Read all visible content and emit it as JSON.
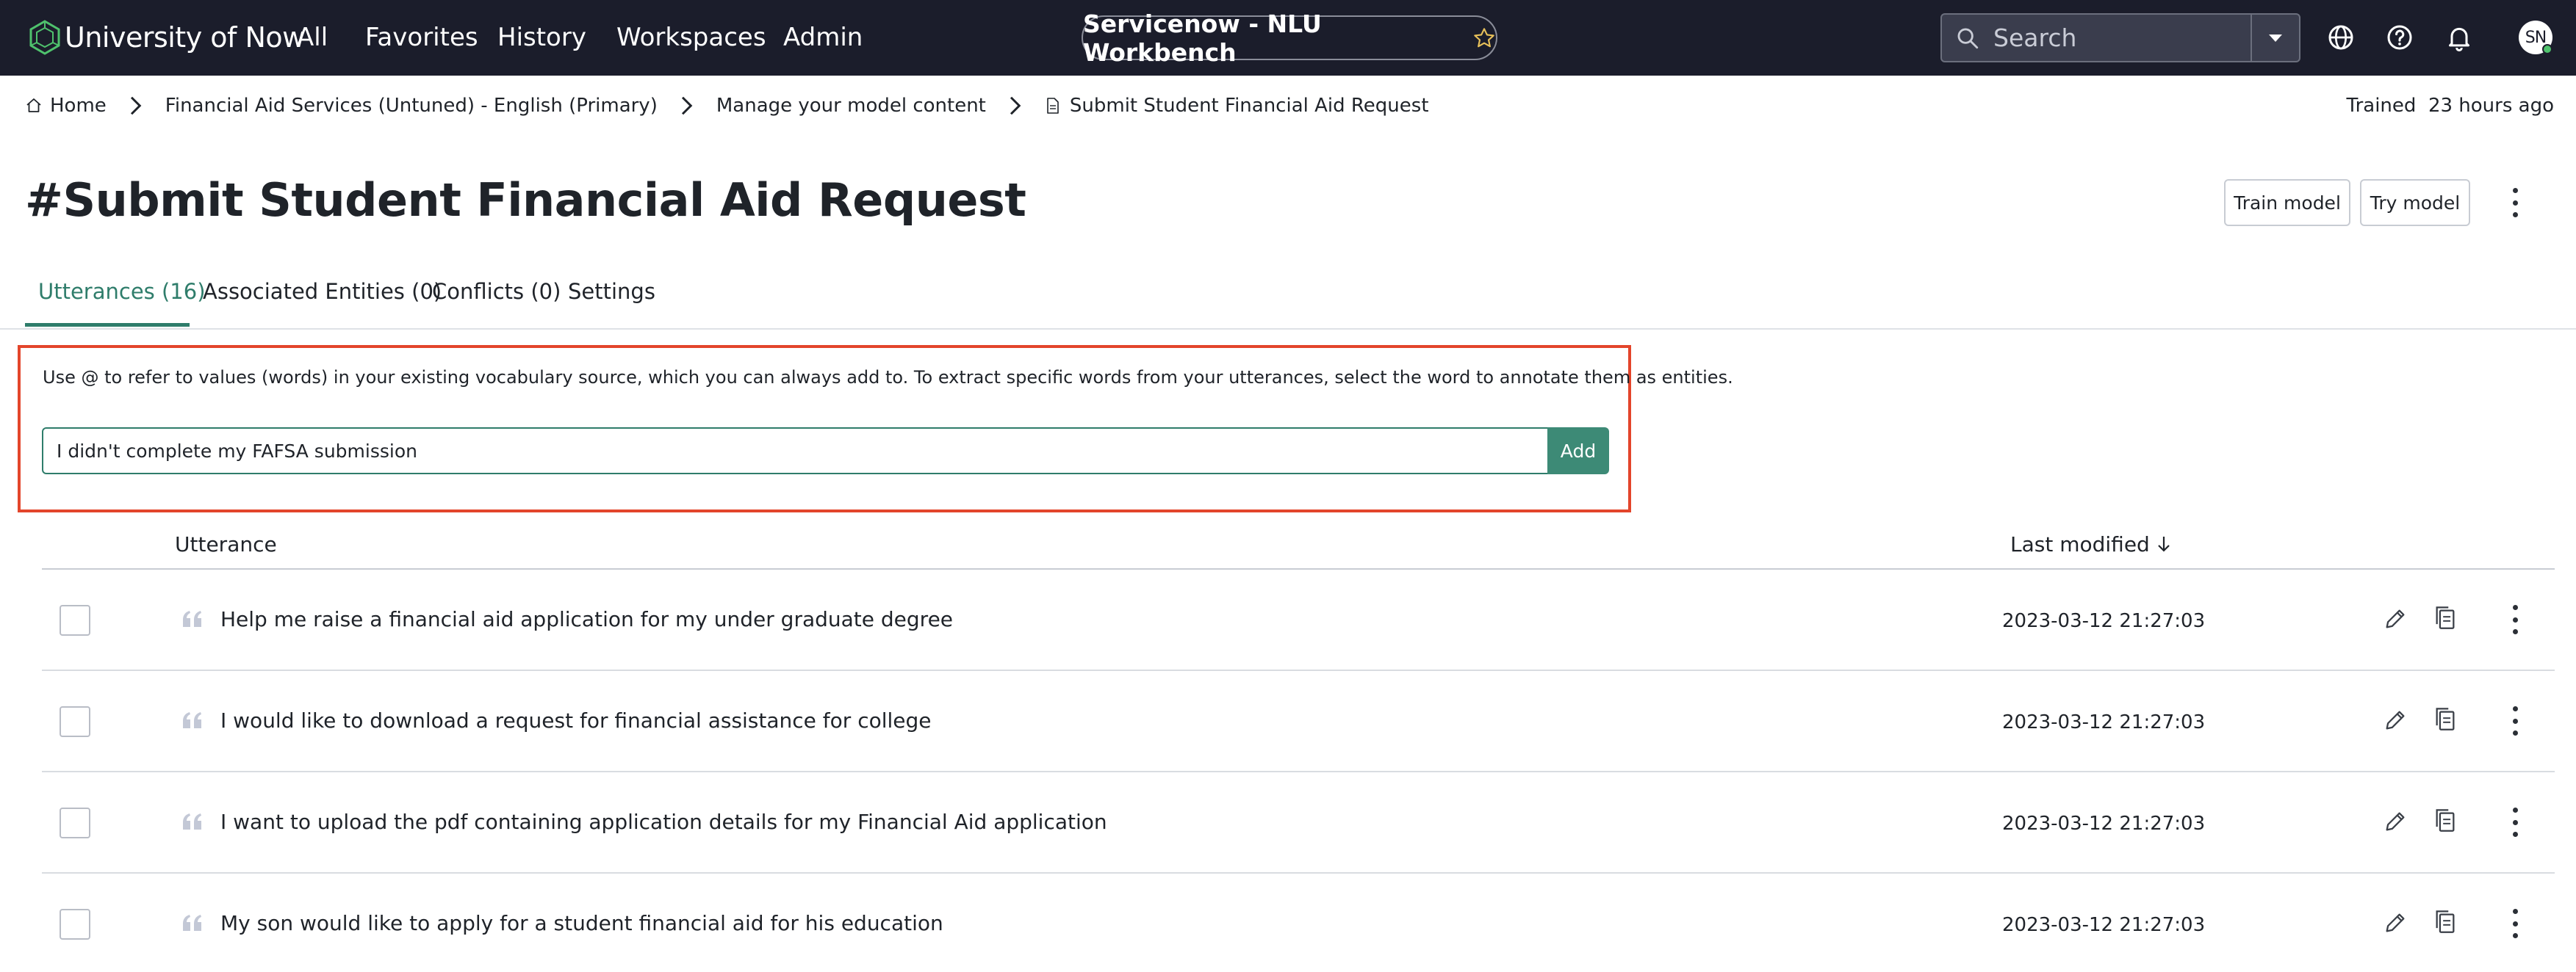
{
  "topbar": {
    "brand": "University of Now",
    "nav": [
      "All",
      "Favorites",
      "History",
      "Workspaces",
      "Admin"
    ],
    "context_title": "Servicenow - NLU Workbench",
    "search_placeholder": "Search",
    "avatar_initials": "SN"
  },
  "breadcrumb": {
    "items": [
      "Home",
      "Financial Aid Services (Untuned) - English (Primary)",
      "Manage your model content",
      "Submit Student Financial Aid Request"
    ],
    "trained_label": "Trained",
    "trained_value": "23 hours ago"
  },
  "page": {
    "title": "#Submit Student Financial Aid Request",
    "train_button": "Train model",
    "try_button": "Try model"
  },
  "tabs": [
    "Utterances (16)",
    "Associated Entities (0)",
    "Conflicts (0)",
    "Settings"
  ],
  "active_tab": 0,
  "composer": {
    "hint": "Use @ to refer to values (words) in your existing vocabulary source, which you can always add to. To extract specific words from your utterances, select the word to annotate them as entities.",
    "input_value": "I didn't complete my FAFSA submission",
    "add_label": "Add"
  },
  "table": {
    "col_utterance": "Utterance",
    "col_modified": "Last modified",
    "rows": [
      {
        "text": "Help me raise a financial aid application for my under graduate degree",
        "modified": "2023-03-12 21:27:03"
      },
      {
        "text": "I would like to download a request for financial assistance for college",
        "modified": "2023-03-12 21:27:03"
      },
      {
        "text": "I want to upload the pdf containing application details for my Financial Aid application",
        "modified": "2023-03-12 21:27:03"
      },
      {
        "text": "My son would like to apply for a student financial aid for his education",
        "modified": "2023-03-12 21:27:03"
      }
    ]
  },
  "colors": {
    "topbar_bg": "#1b1d2b",
    "accent_green": "#2f7d6b",
    "highlight_red": "#e3452b"
  }
}
